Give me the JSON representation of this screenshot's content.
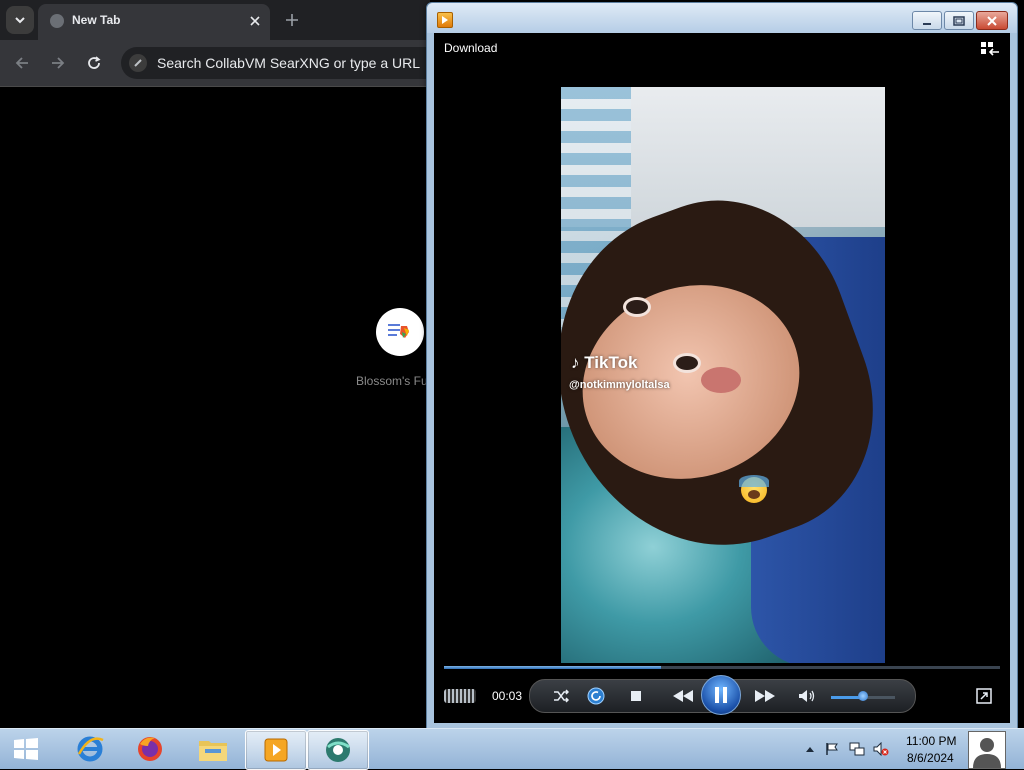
{
  "browser": {
    "tab_title": "New Tab",
    "address_placeholder": "Search CollabVM SearXNG or type a URL",
    "shortcut_label": "Blossom's Fu"
  },
  "player": {
    "menu_label": "Download",
    "elapsed_time": "00:03",
    "progress": 0.39,
    "volume": 0.5,
    "watermark_logo": "TikTok",
    "watermark_handle": "@notkimmyloltalsa"
  },
  "taskbar": {
    "items": [
      "internet-explorer-icon",
      "firefox-icon",
      "file-explorer-icon",
      "media-player-icon",
      "browser-icon"
    ],
    "clock_time": "11:00 PM",
    "clock_date": "8/6/2024"
  },
  "colors": {
    "accent": "#2e6fb8",
    "taskbar": "#a9c4de",
    "close_button": "#c94a33"
  }
}
